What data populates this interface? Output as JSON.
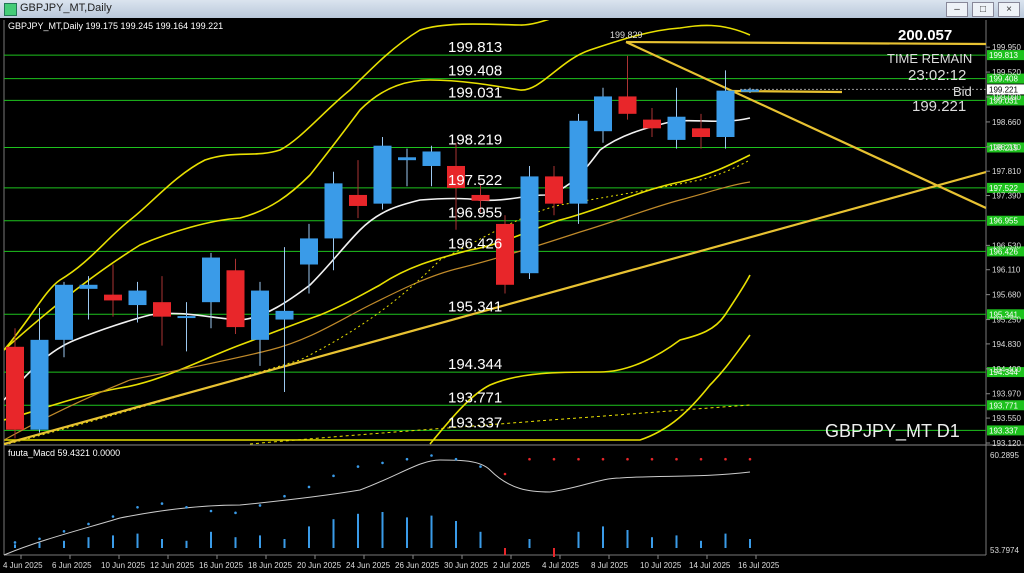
{
  "window": {
    "title": "GBPJPY_MT,Daily",
    "buttons": [
      "–",
      "□",
      "×"
    ]
  },
  "header": {
    "info": "GBPJPY_MT,Daily  199.175 199.245 199.164 199.221"
  },
  "overlay": {
    "high_label": "200.057",
    "time_remain_label": "TIME REMAIN",
    "time_remain_value": "23:02:12",
    "bid_label": "Bid",
    "bid_value": "199.221",
    "symbol_tf": "GBPJPY_MT D1",
    "high_marker": "199.829"
  },
  "colors": {
    "bull": "#3a9be8",
    "bear": "#e8262a",
    "hline": "#1ec21e",
    "band": "#e8e000",
    "trend": "#e8c232",
    "ma_fast": "#f2f2f2",
    "ma_orange": "#c08a2a"
  },
  "macd": {
    "label": "fuuta_Macd 59.4321  0.0000",
    "scale_top": "60.2895",
    "scale_bottom": "53.7974"
  },
  "chart_data": {
    "type": "candlestick",
    "symbol": "GBPJPY_MT",
    "timeframe": "D1",
    "ylim": [
      193.12,
      200.16
    ],
    "price_axis_ticks": [
      "199.950",
      "199.520",
      "199.090",
      "198.660",
      "198.230",
      "197.810",
      "197.390",
      "196.530",
      "196.110",
      "195.680",
      "195.250",
      "194.830",
      "194.400",
      "193.970",
      "193.550",
      "193.120"
    ],
    "level_lines": [
      {
        "value": 199.813,
        "label": "199.813"
      },
      {
        "value": 199.408,
        "label": "199.408"
      },
      {
        "value": 199.031,
        "label": "199.031"
      },
      {
        "value": 198.219,
        "label": "198.219"
      },
      {
        "value": 197.522,
        "label": "197.522"
      },
      {
        "value": 196.955,
        "label": "196.955"
      },
      {
        "value": 196.426,
        "label": "196.426"
      },
      {
        "value": 195.341,
        "label": "195.341"
      },
      {
        "value": 194.344,
        "label": "194.344"
      },
      {
        "value": 193.771,
        "label": "193.771"
      },
      {
        "value": 193.337,
        "label": "193.337"
      }
    ],
    "current_price": {
      "value": 199.221,
      "label": "199.221"
    },
    "date_labels": [
      "4 Jun 2025",
      "6 Jun 2025",
      "10 Jun 2025",
      "12 Jun 2025",
      "16 Jun 2025",
      "18 Jun 2025",
      "20 Jun 2025",
      "24 Jun 2025",
      "26 Jun 2025",
      "30 Jun 2025",
      "2 Jul 2025",
      "4 Jul 2025",
      "8 Jul 2025",
      "10 Jul 2025",
      "14 Jul 2025",
      "16 Jul 2025"
    ],
    "candles": [
      {
        "o": 194.78,
        "h": 195.1,
        "l": 193.2,
        "c": 193.35
      },
      {
        "o": 193.35,
        "h": 195.45,
        "l": 193.3,
        "c": 194.9
      },
      {
        "o": 194.9,
        "h": 195.9,
        "l": 194.6,
        "c": 195.85
      },
      {
        "o": 195.78,
        "h": 196.0,
        "l": 195.25,
        "c": 195.85
      },
      {
        "o": 195.68,
        "h": 196.2,
        "l": 195.3,
        "c": 195.58
      },
      {
        "o": 195.5,
        "h": 195.9,
        "l": 195.2,
        "c": 195.75
      },
      {
        "o": 195.55,
        "h": 196.0,
        "l": 194.8,
        "c": 195.3
      },
      {
        "o": 195.28,
        "h": 195.55,
        "l": 194.7,
        "c": 195.31
      },
      {
        "o": 195.55,
        "h": 196.4,
        "l": 195.1,
        "c": 196.32
      },
      {
        "o": 196.1,
        "h": 196.3,
        "l": 195.0,
        "c": 195.12
      },
      {
        "o": 194.9,
        "h": 195.9,
        "l": 194.45,
        "c": 195.75
      },
      {
        "o": 195.25,
        "h": 196.5,
        "l": 194.0,
        "c": 195.4
      },
      {
        "o": 196.2,
        "h": 196.9,
        "l": 195.7,
        "c": 196.65
      },
      {
        "o": 196.65,
        "h": 197.8,
        "l": 196.1,
        "c": 197.6
      },
      {
        "o": 197.4,
        "h": 198.0,
        "l": 197.0,
        "c": 197.21
      },
      {
        "o": 197.25,
        "h": 198.4,
        "l": 197.15,
        "c": 198.25
      },
      {
        "o": 198.0,
        "h": 198.2,
        "l": 197.55,
        "c": 198.05
      },
      {
        "o": 197.9,
        "h": 198.25,
        "l": 197.55,
        "c": 198.15
      },
      {
        "o": 197.9,
        "h": 198.3,
        "l": 196.8,
        "c": 197.52
      },
      {
        "o": 197.4,
        "h": 197.6,
        "l": 197.1,
        "c": 197.3
      },
      {
        "o": 196.9,
        "h": 197.05,
        "l": 195.7,
        "c": 195.85
      },
      {
        "o": 196.05,
        "h": 197.9,
        "l": 195.95,
        "c": 197.72
      },
      {
        "o": 197.72,
        "h": 197.9,
        "l": 197.05,
        "c": 197.25
      },
      {
        "o": 197.25,
        "h": 198.8,
        "l": 196.9,
        "c": 198.68
      },
      {
        "o": 198.5,
        "h": 199.25,
        "l": 198.3,
        "c": 199.1
      },
      {
        "o": 199.1,
        "h": 199.8,
        "l": 198.7,
        "c": 198.8
      },
      {
        "o": 198.7,
        "h": 198.9,
        "l": 198.4,
        "c": 198.55
      },
      {
        "o": 198.35,
        "h": 199.25,
        "l": 198.2,
        "c": 198.75
      },
      {
        "o": 198.55,
        "h": 198.8,
        "l": 198.2,
        "c": 198.4
      },
      {
        "o": 198.4,
        "h": 199.55,
        "l": 198.2,
        "c": 199.2
      },
      {
        "o": 199.18,
        "h": 199.25,
        "l": 199.16,
        "c": 199.22
      }
    ]
  }
}
